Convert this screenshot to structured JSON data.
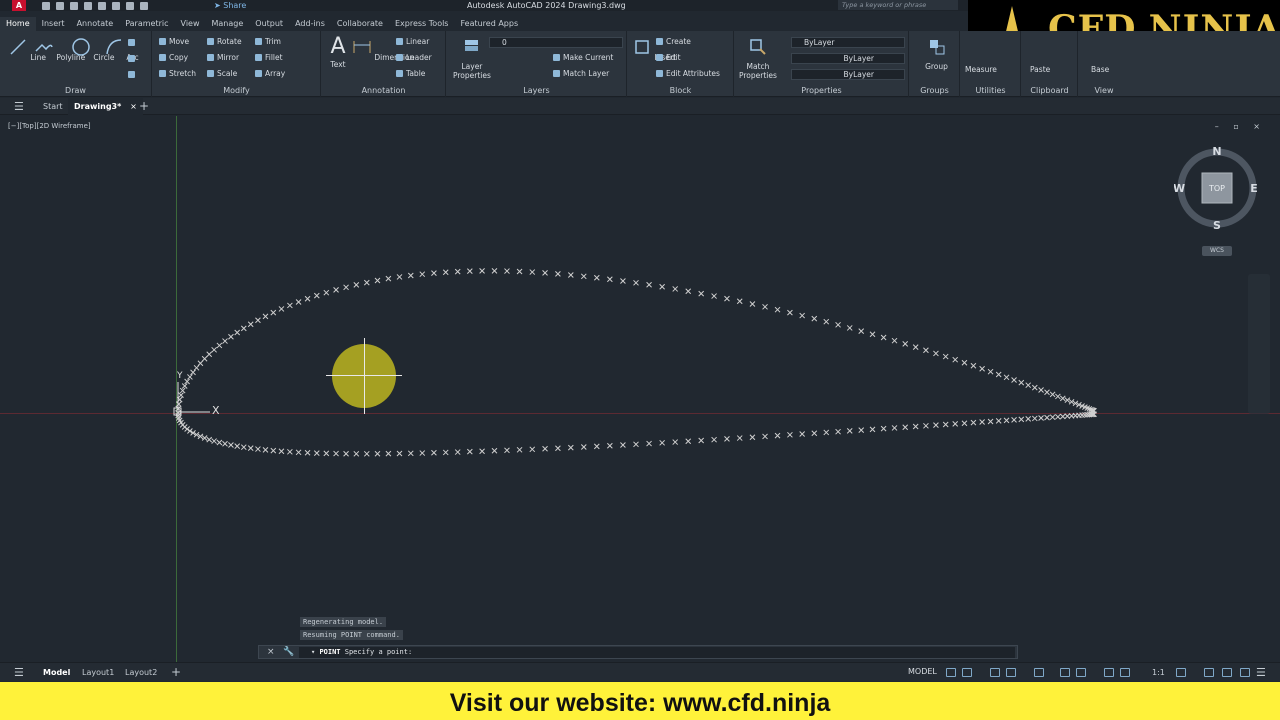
{
  "titlebar": {
    "app_logo": "A",
    "share": "Share",
    "title": "Autodesk AutoCAD 2024    Drawing3.dwg",
    "search_placeholder": "Type a keyword or phrase"
  },
  "brand": {
    "text": "CFD.NINJA"
  },
  "ribbon_tabs": [
    "Home",
    "Insert",
    "Annotate",
    "Parametric",
    "View",
    "Manage",
    "Output",
    "Add-ins",
    "Collaborate",
    "Express Tools",
    "Featured Apps"
  ],
  "ribbon": {
    "draw": {
      "title": "Draw",
      "line": "Line",
      "polyline": "Polyline",
      "circle": "Circle",
      "arc": "Arc"
    },
    "modify": {
      "title": "Modify",
      "move": "Move",
      "rotate": "Rotate",
      "trim": "Trim",
      "copy": "Copy",
      "mirror": "Mirror",
      "fillet": "Fillet",
      "stretch": "Stretch",
      "scale": "Scale",
      "array": "Array"
    },
    "annotation": {
      "title": "Annotation",
      "text": "Text",
      "dimension": "Dimension",
      "linear": "Linear",
      "leader": "Leader",
      "table": "Table"
    },
    "layers": {
      "title": "Layers",
      "layer_properties_1": "Layer",
      "layer_properties_2": "Properties",
      "current_layer": "0",
      "make_current": "Make Current",
      "match_layer": "Match Layer"
    },
    "block": {
      "title": "Block",
      "insert": "Insert",
      "create": "Create",
      "edit": "Edit",
      "edit_attributes": "Edit Attributes"
    },
    "properties": {
      "title": "Properties",
      "match_1": "Match",
      "match_2": "Properties",
      "color": "ByLayer",
      "linetype": "ByLayer",
      "lineweight": "ByLayer"
    },
    "groups": {
      "title": "Groups",
      "group": "Group"
    },
    "utilities": {
      "title": "Utilities",
      "measure": "Measure"
    },
    "clipboard": {
      "title": "Clipboard",
      "paste": "Paste"
    },
    "view": {
      "title": "View",
      "base": "Base"
    }
  },
  "filetabs": {
    "start": "Start",
    "drawing": "Drawing3*",
    "close": "×",
    "add": "+"
  },
  "viewport": {
    "label": "[−][Top][2D Wireframe]",
    "controls": "– ▫ ×",
    "axis_x": "X",
    "axis_y": "Y",
    "viewcube": {
      "north": "N",
      "south": "S",
      "east": "E",
      "west": "W",
      "face": "TOP"
    },
    "wcs": "WCS"
  },
  "command": {
    "history": [
      "Regenerating model.",
      "Resuming POINT command."
    ],
    "close": "×",
    "wrench": "🔧",
    "prompt_cmd": "POINT",
    "prompt_text": " Specify a point:"
  },
  "statusbar": {
    "model_tab": "Model",
    "layout1": "Layout1",
    "layout2": "Layout2",
    "add": "+",
    "model_indicator": "MODEL",
    "scale": "1:1"
  },
  "banner": {
    "text": "Visit our website: www.cfd.ninja"
  },
  "colors": {
    "accent_yellow": "#fff23a",
    "brand_gold": "#e6c24a",
    "background": "#212830",
    "point_marker": "#d0d0d0"
  }
}
